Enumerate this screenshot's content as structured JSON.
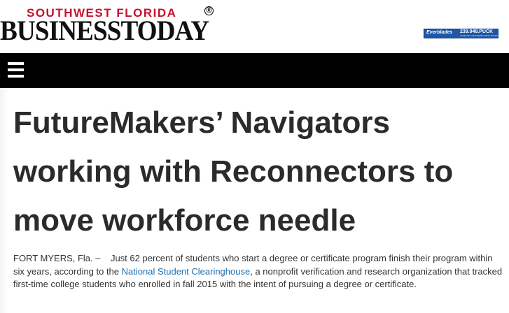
{
  "masthead": {
    "logo_top": "SOUTHWEST FLORIDA",
    "logo_main": "BUSINESSTODAY",
    "registered": "®",
    "ad_brand": "Everblades",
    "ad_phone": "239.948.PUCK",
    "ad_subtext": "HOME OF THE EVERBLADES HOCKEY"
  },
  "nav": {
    "menu_icon": "hamburger-menu-icon"
  },
  "article": {
    "headline": "FutureMakers’ Navigators working with Reconnectors to move workforce needle",
    "dateline": "FORT MYERS, Fla. –",
    "body_before_link": "Just 62 percent of students who start a degree or certificate program finish their program within six years, according to the ",
    "link_text": "National Student Clearinghouse",
    "body_after_link": ", a nonprofit verification and research organization that tracked first-time college students who enrolled in fall 2015 with the intent of pursuing a degree or certificate."
  },
  "colors": {
    "logo_red": "#c8102e",
    "nav_bg": "#000000",
    "headline": "#2b2b2b",
    "link": "#1e6fb3",
    "ad_blue": "#1d57a6"
  }
}
